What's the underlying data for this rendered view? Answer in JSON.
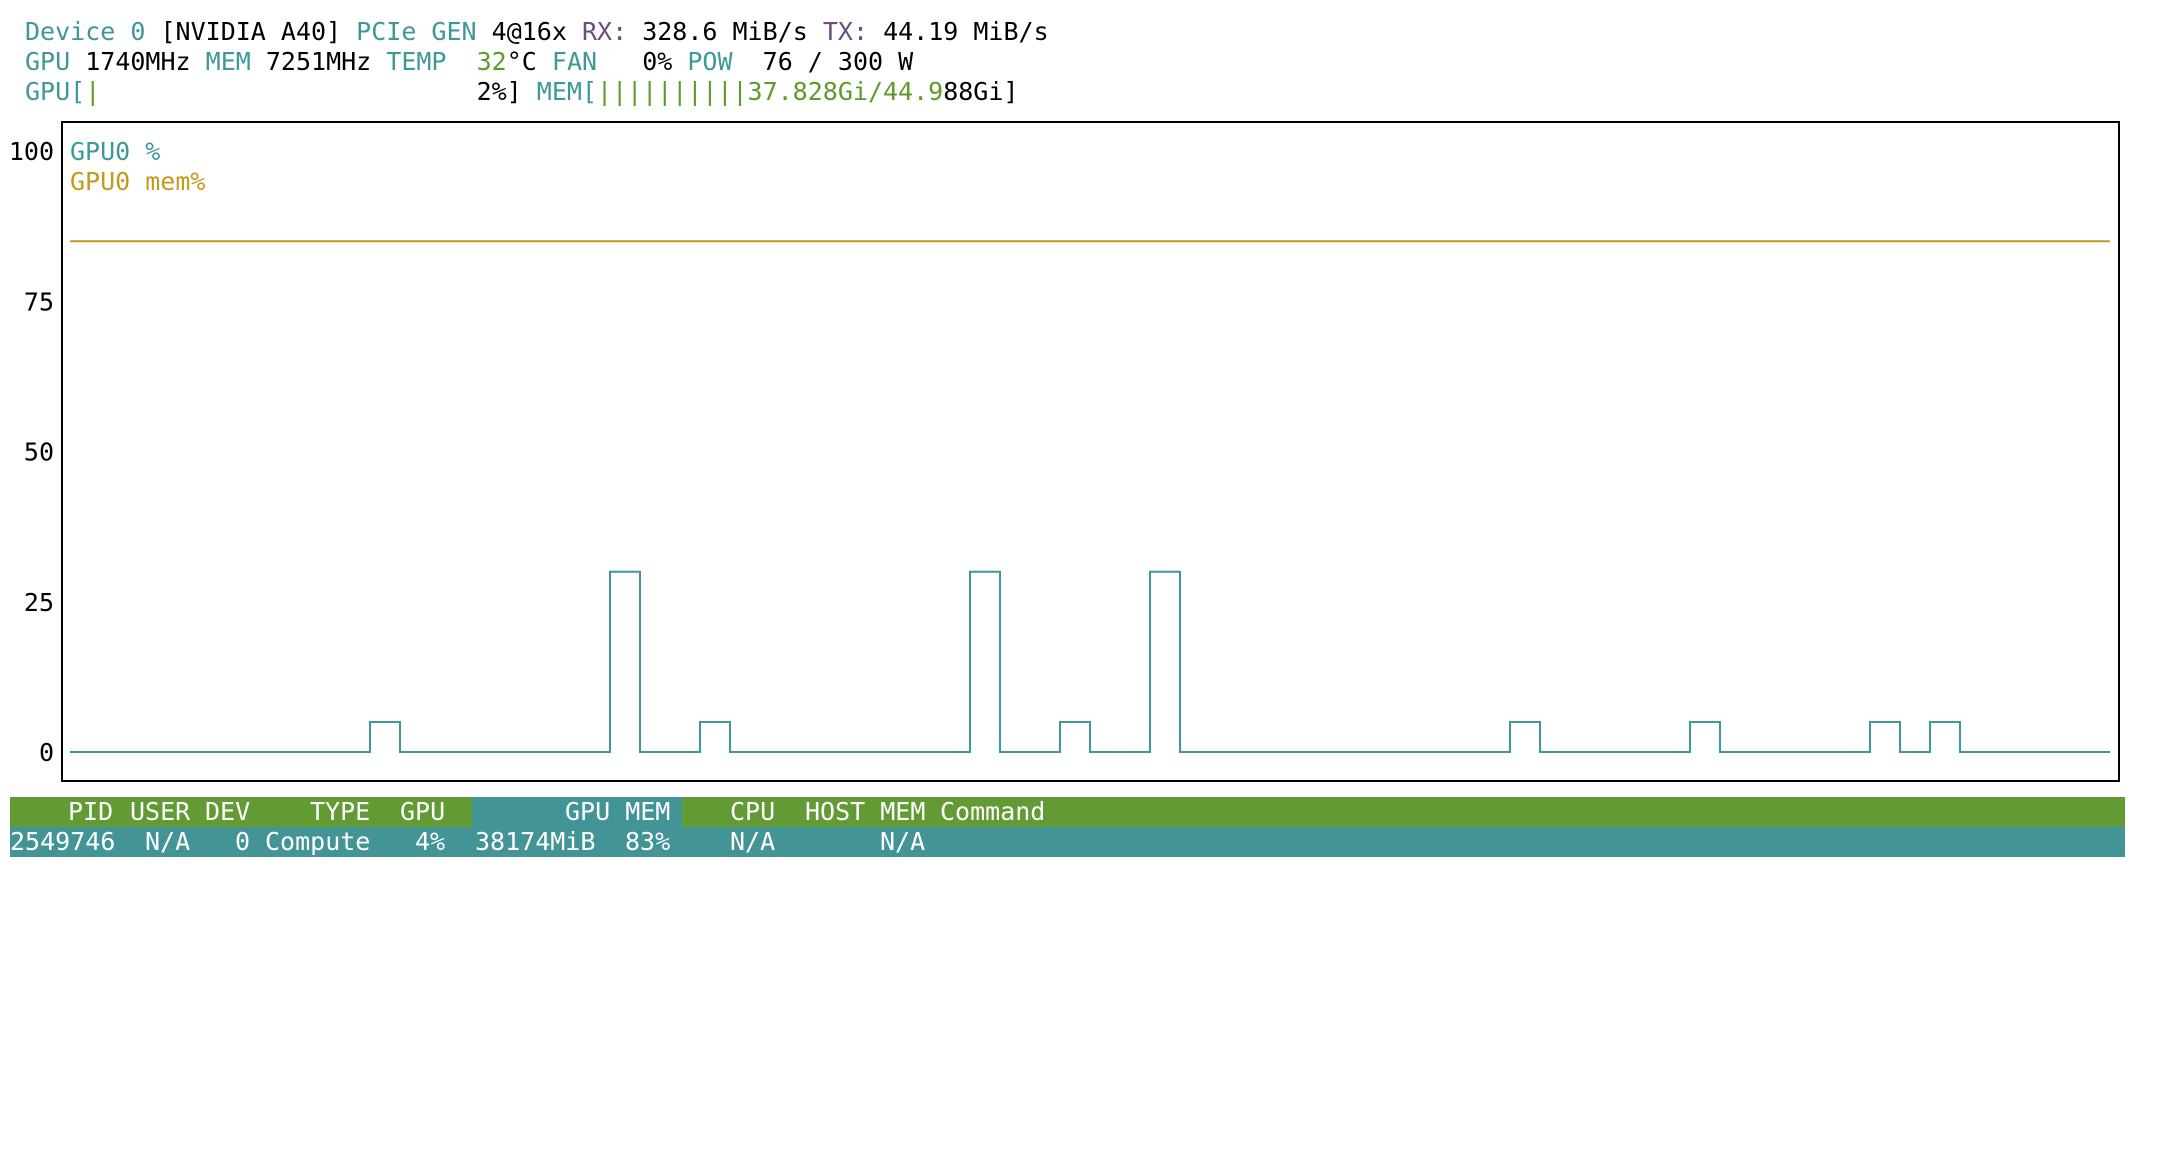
{
  "device": {
    "label": "Device 0",
    "name": "[NVIDIA A40]",
    "pcie_label": "PCIe GEN",
    "pcie_value": "4@16x",
    "rx_label": "RX:",
    "rx_value": "328.6 MiB/s",
    "tx_label": "TX:",
    "tx_value": "44.19 MiB/s"
  },
  "clocks": {
    "gpu_label": "GPU",
    "gpu_value": "1740MHz",
    "mem_label": "MEM",
    "mem_value": "7251MHz",
    "temp_label": "TEMP",
    "temp_value": "32",
    "temp_unit": "°C",
    "fan_label": "FAN",
    "fan_value": "0%",
    "pow_label": "POW",
    "pow_value": "76 / 300 W"
  },
  "bars": {
    "gpu_label": "GPU[",
    "gpu_bar": "|",
    "gpu_value": "2%]",
    "gpu_fraction": 0.02,
    "mem_label": "MEM[",
    "mem_bar": "||||||||||",
    "mem_value_used": "37.828Gi/44.9",
    "mem_value_rest": "88Gi]",
    "mem_fraction": 0.842
  },
  "colors": {
    "teal": "#3e9898",
    "purple": "#6e4b82",
    "green": "#5e9a2c",
    "olive": "#c49a1b",
    "header_green": "#629a34",
    "row_teal": "#429497"
  },
  "chart_data": {
    "type": "line",
    "legend": [
      "GPU0 %",
      "GPU0 mem%"
    ],
    "legend_placement": "top-left",
    "yticks": [
      "100",
      "75",
      "50",
      "25",
      "0"
    ],
    "ylim": [
      0,
      100
    ],
    "xlim": [
      0,
      68
    ],
    "grid": false,
    "series": [
      {
        "name": "GPU0 %",
        "color": "#3e9898",
        "step": true,
        "values": [
          0,
          0,
          0,
          0,
          0,
          0,
          0,
          0,
          0,
          0,
          5,
          0,
          0,
          0,
          0,
          0,
          0,
          0,
          30,
          0,
          0,
          5,
          0,
          0,
          0,
          0,
          0,
          0,
          0,
          0,
          30,
          0,
          0,
          5,
          0,
          0,
          30,
          0,
          0,
          0,
          0,
          0,
          0,
          0,
          0,
          0,
          0,
          0,
          5,
          0,
          0,
          0,
          0,
          0,
          5,
          0,
          0,
          0,
          0,
          0,
          5,
          0,
          5,
          0,
          0,
          0,
          0,
          0
        ]
      },
      {
        "name": "GPU0 mem%",
        "color": "#c49a1b",
        "step": false,
        "values": [
          85,
          85
        ]
      }
    ]
  },
  "process_table": {
    "headers": {
      "pid": "PID",
      "user": "USER",
      "dev": "DEV",
      "type": "TYPE",
      "gpu": "GPU",
      "gpu_mem": "GPU MEM",
      "cpu": "CPU",
      "host_mem": "HOST MEM",
      "command": "Command"
    },
    "rows": [
      {
        "pid": "2549746",
        "user": "N/A",
        "dev": "0",
        "type": "Compute",
        "gpu": "4%",
        "gpu_mem": "38174MiB",
        "gpu_mem_pct": "83%",
        "cpu": "N/A",
        "host_mem": "N/A",
        "command": ""
      }
    ]
  }
}
